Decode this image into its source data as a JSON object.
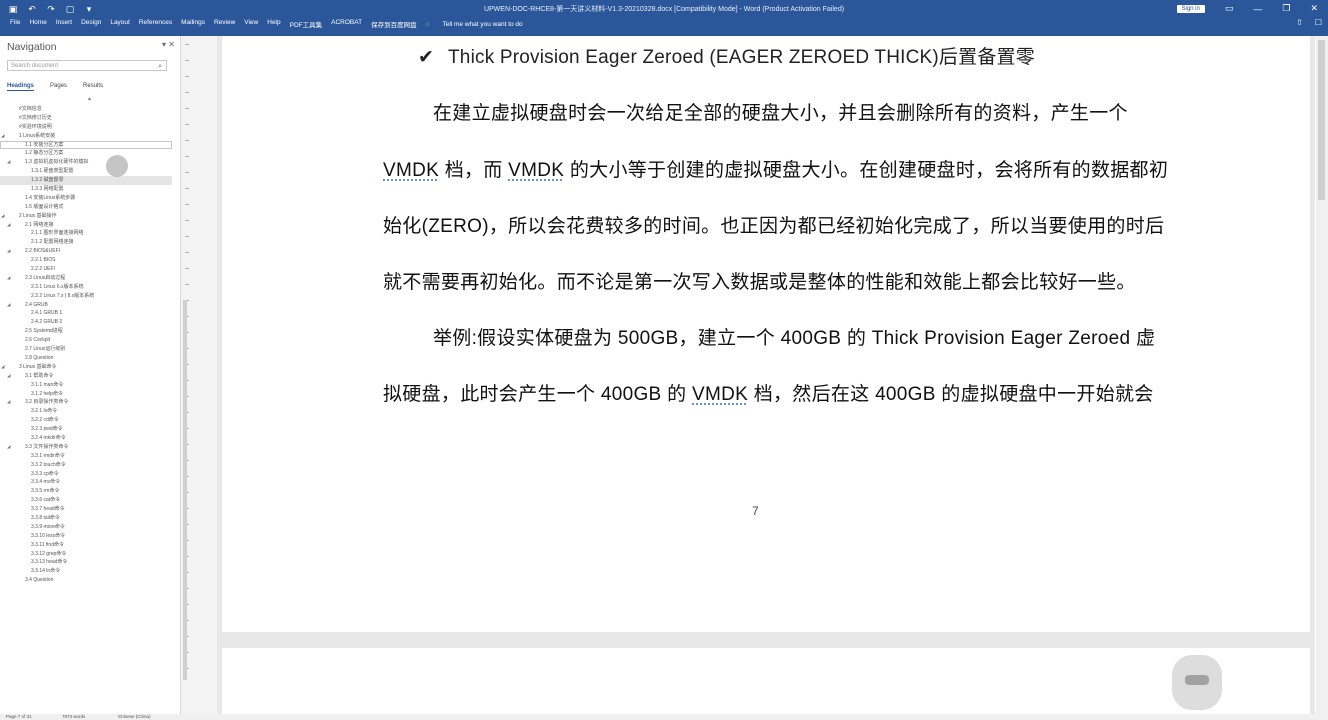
{
  "window": {
    "title": "UPWEN-DOC-RHCE8-第一天讲义材料-V1.3-20210328.docx [Compatibility Mode] - Word (Product Activation Failed)",
    "sign_in": "Sign in"
  },
  "menu": [
    "File",
    "Home",
    "Insert",
    "Design",
    "Layout",
    "References",
    "Mailings",
    "Review",
    "View",
    "Help",
    "PDF工具集",
    "ACROBAT",
    "保存到百度网盘"
  ],
  "tell_me": "Tell me what you want to do",
  "nav": {
    "title": "Navigation",
    "search_placeholder": "Search document",
    "tabs": [
      "Headings",
      "Pages",
      "Results"
    ],
    "items": [
      {
        "text": "#文档信息",
        "level": 0,
        "chev": false
      },
      {
        "text": "#文档修订历史",
        "level": 0,
        "chev": false
      },
      {
        "text": "#实验环境说明",
        "level": 0,
        "chev": false
      },
      {
        "text": "1 Linux系统安装",
        "level": 0,
        "chev": true
      },
      {
        "text": "1.1 安装分区方案",
        "level": 1,
        "chev": false,
        "hov": true
      },
      {
        "text": "1.2 静态分区方案",
        "level": 1,
        "chev": false
      },
      {
        "text": "1.3 虚拟机虚拟化硬件的模拟",
        "level": 1,
        "chev": true
      },
      {
        "text": "1.3.1 硬盘类型配置",
        "level": 2,
        "chev": false
      },
      {
        "text": "1.3.2 磁盘置零",
        "level": 2,
        "chev": false,
        "sel": true
      },
      {
        "text": "1.3.3 网络配置",
        "level": 2,
        "chev": false
      },
      {
        "text": "1.4 安装Linux系统步骤",
        "level": 1,
        "chev": false
      },
      {
        "text": "1.5 版面设计格式",
        "level": 1,
        "chev": false
      },
      {
        "text": "2 Linux 基础操作",
        "level": 0,
        "chev": true
      },
      {
        "text": "2.1 网络连接",
        "level": 1,
        "chev": true
      },
      {
        "text": "2.1.1 图形界面连接网络",
        "level": 2,
        "chev": false
      },
      {
        "text": "2.1.2 配置网络连接",
        "level": 2,
        "chev": false
      },
      {
        "text": "2.2 BIOS&UEFI",
        "level": 1,
        "chev": true
      },
      {
        "text": "2.2.1 BIOS",
        "level": 2,
        "chev": false
      },
      {
        "text": "2.2.2 UEFI",
        "level": 2,
        "chev": false
      },
      {
        "text": "2.3 Linux启动过程",
        "level": 1,
        "chev": true
      },
      {
        "text": "2.3.1 Linux 6.x版本系统",
        "level": 2,
        "chev": false
      },
      {
        "text": "2.3.2 Linux 7.x | 8.x版本系统",
        "level": 2,
        "chev": false
      },
      {
        "text": "2.4 GRUB",
        "level": 1,
        "chev": true
      },
      {
        "text": "2.4.1 GRUB 1",
        "level": 2,
        "chev": false
      },
      {
        "text": "2.4.2 GRUB 2",
        "level": 2,
        "chev": false
      },
      {
        "text": "2.5 Systemd进程",
        "level": 1,
        "chev": false
      },
      {
        "text": "2.6 Cockpit",
        "level": 1,
        "chev": false
      },
      {
        "text": "2.7 Linux运行级别",
        "level": 1,
        "chev": false
      },
      {
        "text": "2.8 Question",
        "level": 1,
        "chev": false
      },
      {
        "text": "3 Linux 基础命令",
        "level": 0,
        "chev": true
      },
      {
        "text": "3.1 帮助命令",
        "level": 1,
        "chev": true
      },
      {
        "text": "3.1.1 man命令",
        "level": 2,
        "chev": false
      },
      {
        "text": "3.1.2 help命令",
        "level": 2,
        "chev": false
      },
      {
        "text": "3.2 目录操作类命令",
        "level": 1,
        "chev": true
      },
      {
        "text": "3.2.1 ls命令",
        "level": 2,
        "chev": false
      },
      {
        "text": "3.2.2 cd命令",
        "level": 2,
        "chev": false
      },
      {
        "text": "3.2.3 pwd命令",
        "level": 2,
        "chev": false
      },
      {
        "text": "3.2.4 mkdir命令",
        "level": 2,
        "chev": false
      },
      {
        "text": "3.3 文件操作类命令",
        "level": 1,
        "chev": true
      },
      {
        "text": "3.3.1 rmdir命令",
        "level": 2,
        "chev": false
      },
      {
        "text": "3.3.2 touch命令",
        "level": 2,
        "chev": false
      },
      {
        "text": "3.3.3 cp命令",
        "level": 2,
        "chev": false
      },
      {
        "text": "3.3.4 mv命令",
        "level": 2,
        "chev": false
      },
      {
        "text": "3.3.5 rm命令",
        "level": 2,
        "chev": false
      },
      {
        "text": "3.3.6 cat命令",
        "level": 2,
        "chev": false
      },
      {
        "text": "3.3.7 head命令",
        "level": 2,
        "chev": false
      },
      {
        "text": "3.3.8 tail命令",
        "level": 2,
        "chev": false
      },
      {
        "text": "3.3.9 more命令",
        "level": 2,
        "chev": false
      },
      {
        "text": "3.3.10 less命令",
        "level": 2,
        "chev": false
      },
      {
        "text": "3.3.11 find命令",
        "level": 2,
        "chev": false
      },
      {
        "text": "3.3.12 grep命令",
        "level": 2,
        "chev": false
      },
      {
        "text": "3.3.13 head命令",
        "level": 2,
        "chev": false
      },
      {
        "text": "3.3.14 ln命令",
        "level": 2,
        "chev": false
      },
      {
        "text": "3.4 Question",
        "level": 1,
        "chev": false
      }
    ]
  },
  "doc": {
    "heading": "Thick Provision Eager Zeroed (EAGER ZEROED THICK)后置备置零",
    "p1_l1": "在建立虚拟硬盘时会一次给足全部的硬盘大小，并且会删除所有的资料，产生一个",
    "p1_l2a": "VMDK",
    "p1_l2b": " 档，而 ",
    "p1_l2c": "VMDK",
    "p1_l2d": " 的大小等于创建的虚拟硬盘大小。在创建硬盘时，会将所有的数据都初",
    "p1_l3": "始化(ZERO)，所以会花费较多的时间。也正因为都已经初始化完成了，所以当要使用的时后",
    "p1_l4": "就不需要再初始化。而不论是第一次写入数据或是整体的性能和效能上都会比较好一些。",
    "p2_l1": "举例:假设实体硬盘为 500GB，建立一个 400GB 的 Thick Provision Eager Zeroed  虚",
    "p2_l2a": "拟硬盘，此时会产生一个 400GB 的 ",
    "p2_l2b": "VMDK",
    "p2_l2c": " 档，然后在这 400GB 的虚拟硬盘中一开始就会",
    "page_number": "7"
  },
  "status": {
    "page": "Page 7 of 31",
    "words": "7973 words",
    "language": "Chinese (China)"
  }
}
